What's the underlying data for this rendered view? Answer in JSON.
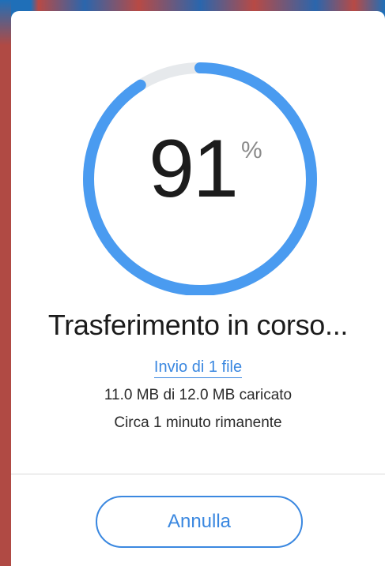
{
  "progress": {
    "value": "91",
    "unit": "%",
    "fraction": 0.91,
    "track_color": "#e6e9ec",
    "fill_color": "#4a9bf0"
  },
  "status": {
    "title": "Trasferimento in corso...",
    "file_link": "Invio di 1 file",
    "size_text": "11.0 MB di 12.0 MB caricato",
    "time_text": "Circa 1 minuto rimanente"
  },
  "actions": {
    "cancel_label": "Annulla"
  },
  "colors": {
    "accent": "#3b88e0",
    "text": "#1c1c1c",
    "muted": "#8a8a8a",
    "divider": "#d9d9d9"
  }
}
